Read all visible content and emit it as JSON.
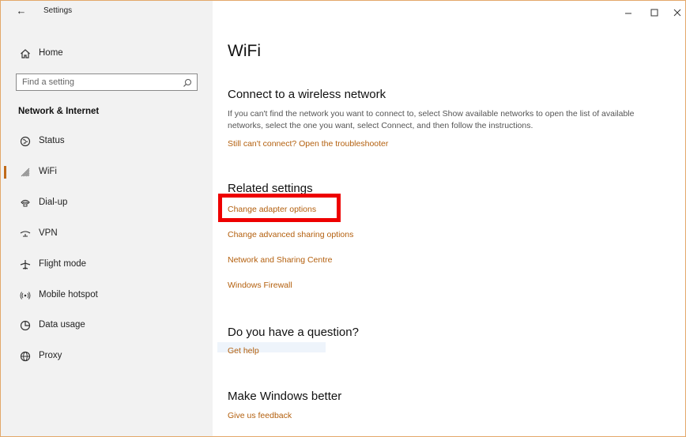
{
  "window": {
    "title": "Settings",
    "controls": {
      "minimize": "minimize-icon",
      "maximize": "maximize-icon",
      "close": "close-icon"
    }
  },
  "sidebar": {
    "home_label": "Home",
    "search": {
      "placeholder": "Find a setting",
      "value": ""
    },
    "section_header": "Network & Internet",
    "items": [
      {
        "label": "Status",
        "icon": "status-globe-icon",
        "active": false
      },
      {
        "label": "WiFi",
        "icon": "wifi-icon",
        "active": true
      },
      {
        "label": "Dial-up",
        "icon": "dialup-phone-icon",
        "active": false
      },
      {
        "label": "VPN",
        "icon": "vpn-icon",
        "active": false
      },
      {
        "label": "Flight mode",
        "icon": "airplane-icon",
        "active": false
      },
      {
        "label": "Mobile hotspot",
        "icon": "hotspot-icon",
        "active": false
      },
      {
        "label": "Data usage",
        "icon": "data-usage-icon",
        "active": false
      },
      {
        "label": "Proxy",
        "icon": "proxy-globe-icon",
        "active": false
      }
    ]
  },
  "main": {
    "title": "WiFi",
    "connect": {
      "heading": "Connect to a wireless network",
      "description": "If you can't find the network you want to connect to, select Show available networks to open the list of available networks, select the one you want, select Connect, and then follow the instructions.",
      "troubleshoot_link": "Still can't connect? Open the troubleshooter"
    },
    "related": {
      "heading": "Related settings",
      "links": [
        "Change adapter options",
        "Change advanced sharing options",
        "Network and Sharing Centre",
        "Windows Firewall"
      ]
    },
    "question": {
      "heading": "Do you have a question?",
      "link": "Get help"
    },
    "better": {
      "heading": "Make Windows better",
      "link": "Give us feedback"
    }
  },
  "colors": {
    "accent": "#b35f0d",
    "highlight": "#ee0000",
    "sidebar_bg": "#f2f2f2"
  }
}
